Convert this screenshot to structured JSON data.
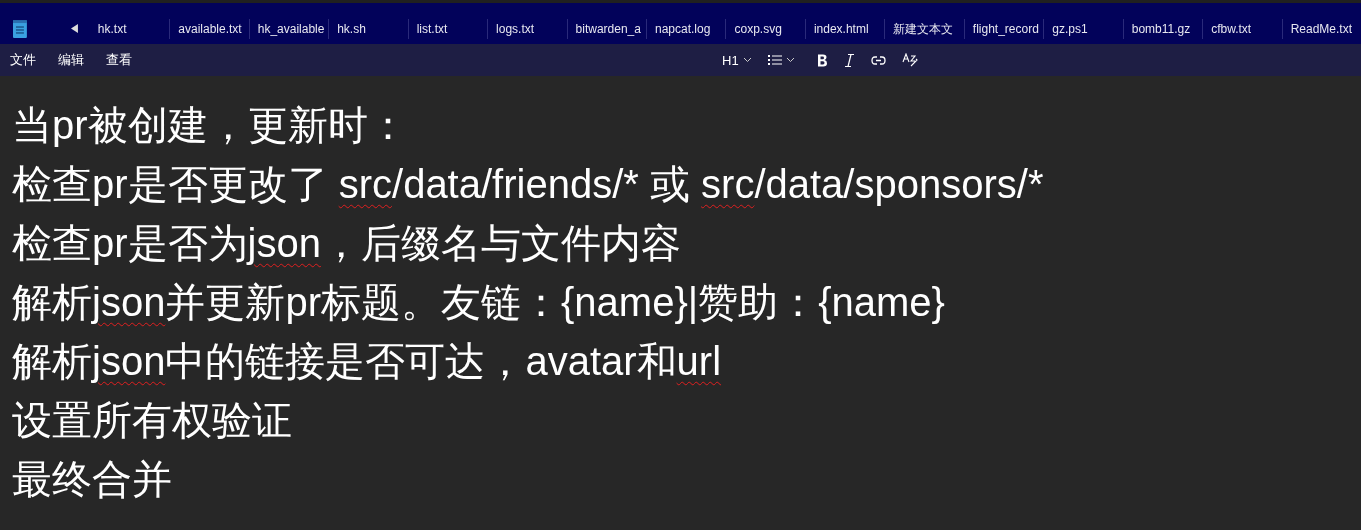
{
  "tabs": [
    {
      "label": "hk.txt",
      "selected": false
    },
    {
      "label": "available.txt",
      "selected": false
    },
    {
      "label": "hk_available",
      "selected": false
    },
    {
      "label": "hk.sh",
      "selected": false
    },
    {
      "label": "list.txt",
      "selected": false
    },
    {
      "label": "logs.txt",
      "selected": false
    },
    {
      "label": "bitwarden_a",
      "selected": false
    },
    {
      "label": "napcat.log",
      "selected": false
    },
    {
      "label": "coxp.svg",
      "selected": false
    },
    {
      "label": "index.html",
      "selected": false
    },
    {
      "label": "新建文本文",
      "selected": false
    },
    {
      "label": "flight_record",
      "selected": false
    },
    {
      "label": "gz.ps1",
      "selected": false
    },
    {
      "label": "bomb11.gz",
      "selected": false
    },
    {
      "label": "cfbw.txt",
      "selected": false
    },
    {
      "label": "ReadMe.txt",
      "selected": false
    }
  ],
  "menu": [
    "文件",
    "编辑",
    "查看"
  ],
  "toolbar": {
    "heading": "H1"
  },
  "document": {
    "lines": [
      [
        {
          "text": "当pr被创建，更新时：",
          "misspelled": false
        }
      ],
      [
        {
          "text": "检查pr是否更改了 ",
          "misspelled": false
        },
        {
          "text": "src",
          "misspelled": true
        },
        {
          "text": "/data/friends/* 或 ",
          "misspelled": false
        },
        {
          "text": "src",
          "misspelled": true
        },
        {
          "text": "/data/sponsors/*",
          "misspelled": false
        }
      ],
      [
        {
          "text": "检查pr是否为",
          "misspelled": false
        },
        {
          "text": "json",
          "misspelled": true
        },
        {
          "text": "，后缀名与文件内容",
          "misspelled": false
        }
      ],
      [
        {
          "text": "解析",
          "misspelled": false
        },
        {
          "text": "json",
          "misspelled": true
        },
        {
          "text": "并更新pr标题。友链：{name}|赞助：{name}",
          "misspelled": false
        }
      ],
      [
        {
          "text": "解析",
          "misspelled": false
        },
        {
          "text": "json",
          "misspelled": true
        },
        {
          "text": "中的链接是否可达，avatar和",
          "misspelled": false
        },
        {
          "text": "url",
          "misspelled": true
        }
      ],
      [
        {
          "text": "设置所有权验证",
          "misspelled": false
        }
      ],
      [
        {
          "text": "最终合并",
          "misspelled": false
        }
      ]
    ]
  }
}
